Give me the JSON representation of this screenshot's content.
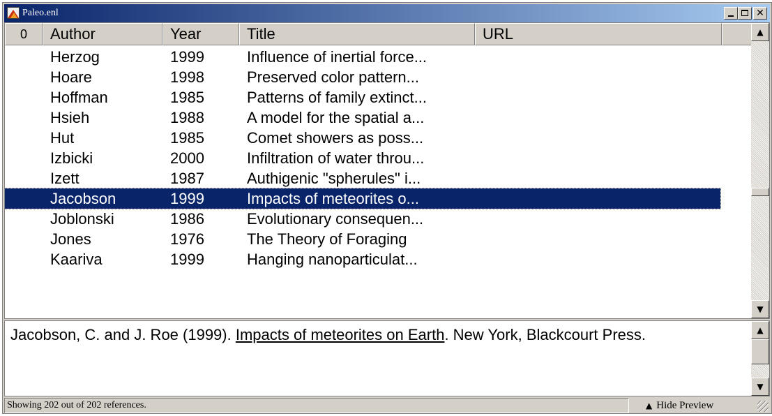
{
  "window": {
    "title": "Paleo.enl",
    "icon": "endnote-library-icon"
  },
  "list": {
    "columns": {
      "attachment": "0",
      "author": "Author",
      "year": "Year",
      "title": "Title",
      "url": "URL"
    },
    "rows": [
      {
        "author": "Herzog",
        "year": "1999",
        "title": "Influence of inertial force..."
      },
      {
        "author": "Hoare",
        "year": "1998",
        "title": "Preserved color pattern..."
      },
      {
        "author": "Hoffman",
        "year": "1985",
        "title": "Patterns of family extinct..."
      },
      {
        "author": "Hsieh",
        "year": "1988",
        "title": "A model for the spatial a..."
      },
      {
        "author": "Hut",
        "year": "1985",
        "title": "Comet showers as poss..."
      },
      {
        "author": "Izbicki",
        "year": "2000",
        "title": "Infiltration of water throu..."
      },
      {
        "author": "Izett",
        "year": "1987",
        "title": "Authigenic \"spherules\" i..."
      },
      {
        "author": "Jacobson",
        "year": "1999",
        "title": "Impacts of meteorites o...",
        "selected": true
      },
      {
        "author": "Joblonski",
        "year": "1986",
        "title": "Evolutionary consequen..."
      },
      {
        "author": "Jones",
        "year": "1976",
        "title": "The Theory of Foraging"
      },
      {
        "author": "Kaariva",
        "year": "1999",
        "title": "Hanging nanoparticulat..."
      }
    ]
  },
  "preview": {
    "authors": "Jacobson, C. and J. Roe (1999). ",
    "title": "Impacts of meteorites on Earth",
    "rest": ". New York, Blackcourt Press."
  },
  "status": {
    "text": "Showing 202 out of 202 references.",
    "hide_preview_label": "Hide Preview"
  }
}
